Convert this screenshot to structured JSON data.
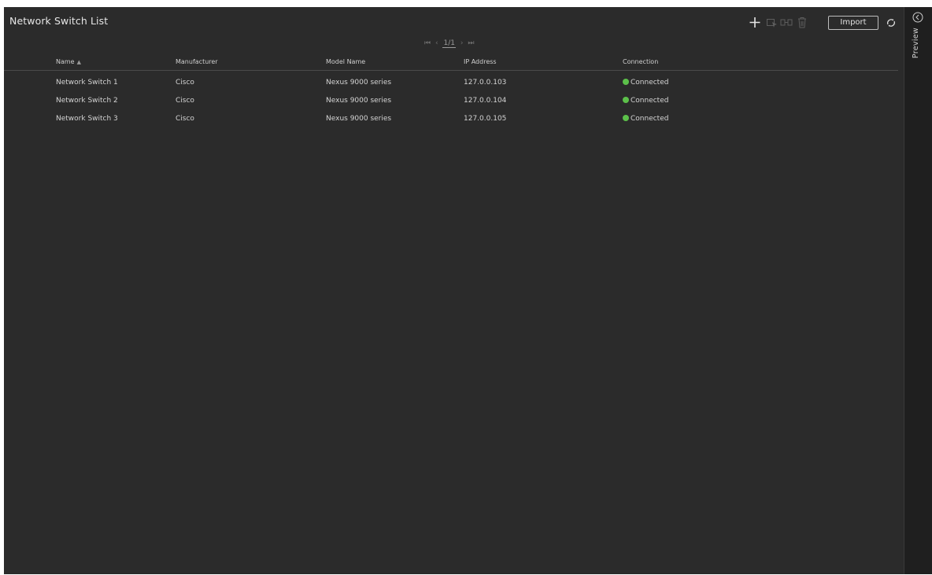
{
  "window": {
    "title": "Network Switch List"
  },
  "toolbar": {
    "add_icon": "plus-icon",
    "select_icon": "select-cursor-icon",
    "link_icon": "link-icon",
    "delete_icon": "trash-icon",
    "import_label": "Import",
    "refresh_icon": "refresh-icon"
  },
  "pager": {
    "first_icon": "first-page-icon",
    "prev_icon": "prev-page-icon",
    "text": "1/1",
    "next_icon": "next-page-icon",
    "last_icon": "last-page-icon"
  },
  "table": {
    "columns": [
      "Name",
      "Manufacturer",
      "Model Name",
      "IP Address",
      "Connection"
    ],
    "sort": {
      "column": "Name",
      "direction": "ascending",
      "icon": "sort-asc-icon"
    },
    "rows": [
      {
        "name": "Network Switch 1",
        "manufacturer": "Cisco",
        "model": "Nexus 9000 series",
        "ip": "127.0.0.103",
        "connection": "Connected"
      },
      {
        "name": "Network Switch 2",
        "manufacturer": "Cisco",
        "model": "Nexus 9000 series",
        "ip": "127.0.0.104",
        "connection": "Connected"
      },
      {
        "name": "Network Switch 3",
        "manufacturer": "Cisco",
        "model": "Nexus 9000 series",
        "ip": "127.0.0.105",
        "connection": "Connected"
      }
    ]
  },
  "side_panel": {
    "label": "Preview",
    "collapse_icon": "chevron-left-circle-icon"
  },
  "colors": {
    "background": "#2b2b2b",
    "side_panel": "#1f1f1f",
    "connected": "#5cc04a"
  }
}
